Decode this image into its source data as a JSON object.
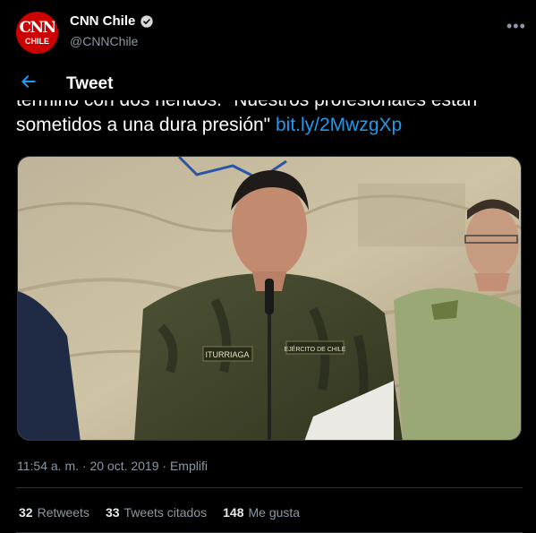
{
  "account": {
    "logo_top": "CNN",
    "logo_bottom": "CHILE",
    "display_name": "CNN Chile",
    "handle": "@CNNChile",
    "more_icon": "more-horizontal-icon"
  },
  "header": {
    "title": "Tweet",
    "back_icon": "arrow-left-icon"
  },
  "tweet": {
    "text_line1": "término con dos heridos. \"Nuestros profesionales están",
    "text_line2": "sometidos a una dura presión\" ",
    "link": "bit.ly/2MwzgXp",
    "media": {
      "badge_name": "ITURRIAGA",
      "badge_unit": "EJÉRCITO DE CHILE"
    },
    "meta": "11:54 a. m. · 20 oct. 2019 · Emplifi"
  },
  "stats": {
    "retweets_count": "32",
    "retweets_label": "Retweets",
    "quotes_count": "33",
    "quotes_label": "Tweets citados",
    "likes_count": "148",
    "likes_label": "Me gusta"
  },
  "colors": {
    "background": "#000000",
    "accent": "#1d9bf0",
    "brand": "#cc0000",
    "muted": "#8b98a5"
  }
}
